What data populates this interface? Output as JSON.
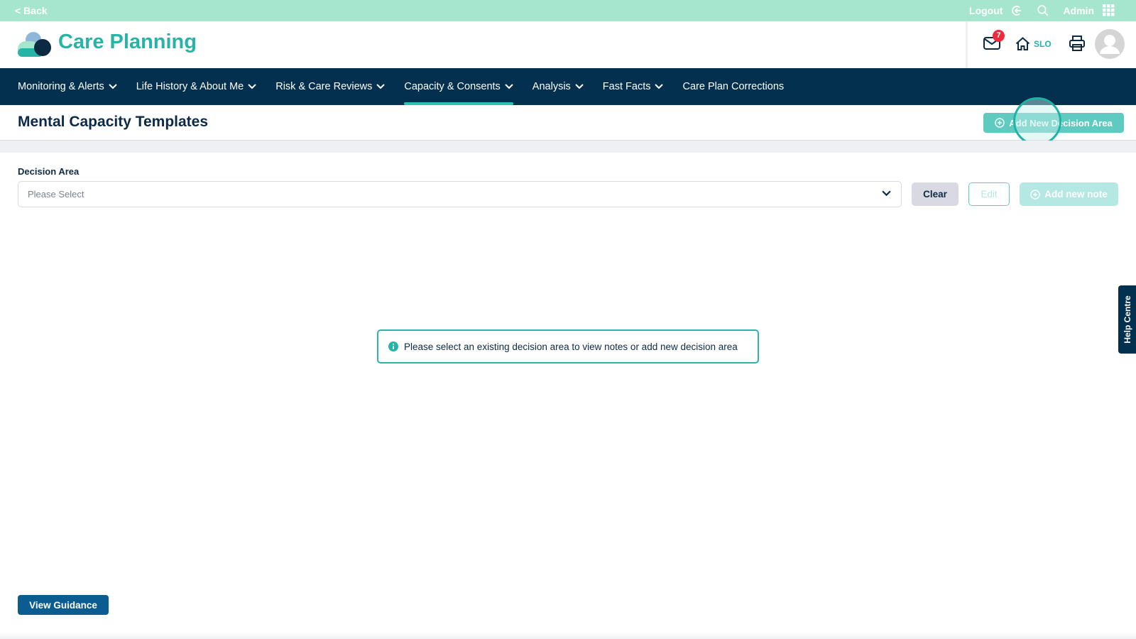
{
  "topbar": {
    "back": "< Back",
    "logout": "Logout",
    "user": "Admin"
  },
  "header": {
    "app_title": "Care Planning",
    "notifications_count": "7",
    "home_label": "SLO"
  },
  "nav": {
    "items": [
      {
        "label": "Monitoring & Alerts",
        "dropdown": true
      },
      {
        "label": "Life History & About Me",
        "dropdown": true
      },
      {
        "label": "Risk & Care Reviews",
        "dropdown": true
      },
      {
        "label": "Capacity & Consents",
        "dropdown": true,
        "active": true
      },
      {
        "label": "Analysis",
        "dropdown": true
      },
      {
        "label": "Fast Facts",
        "dropdown": true
      },
      {
        "label": "Care Plan Corrections",
        "dropdown": false
      }
    ]
  },
  "page": {
    "title": "Mental Capacity Templates",
    "add_decision_area": "Add New Decision Area"
  },
  "form": {
    "decision_area_label": "Decision Area",
    "select_placeholder": "Please Select",
    "clear": "Clear",
    "edit": "Edit",
    "add_note": "Add new note"
  },
  "info_message": "Please select an existing decision area to view notes or add new decision area",
  "footer": {
    "view_guidance": "View Guidance"
  },
  "help_centre": "Help Centre",
  "colors": {
    "topbar": "#a6e6cf",
    "nav": "#03304f",
    "accent": "#27b3a6",
    "primary_button": "#0b5d91"
  }
}
